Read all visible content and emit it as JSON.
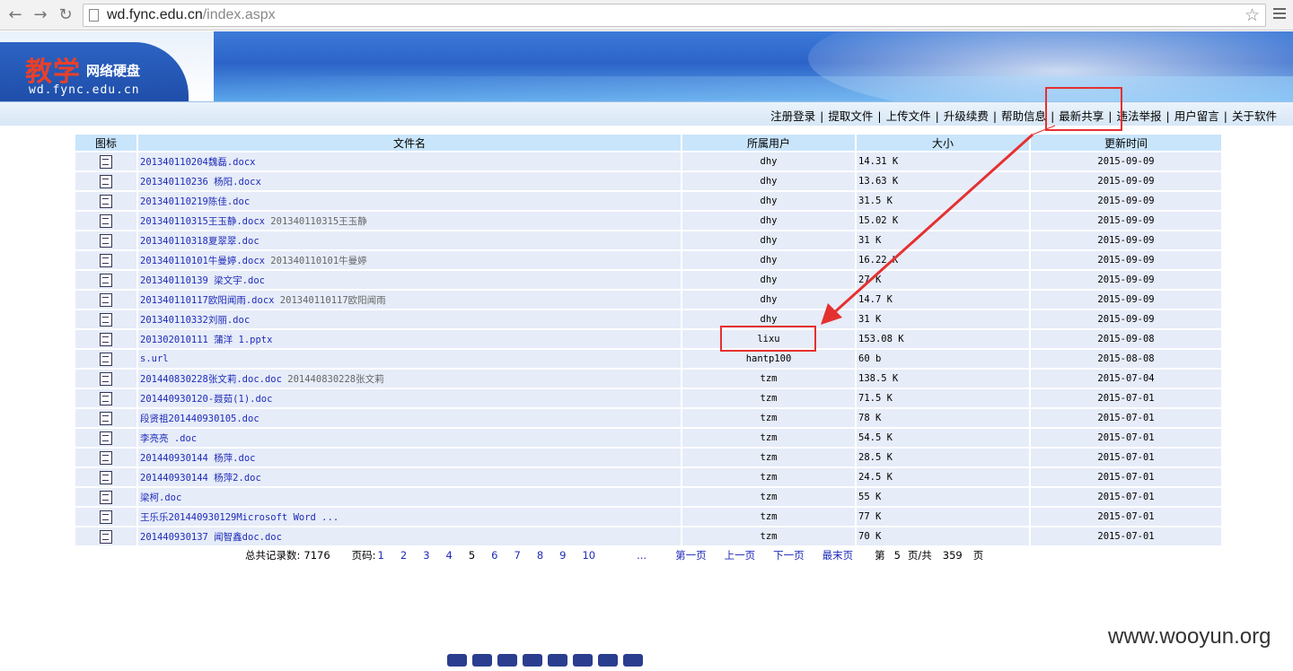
{
  "browser": {
    "url_host": "wd.fync.edu.cn",
    "url_path": "/index.aspx"
  },
  "header": {
    "logo_title": "教学",
    "logo_sub": "网络硬盘",
    "logo_domain": "wd.fync.edu.cn"
  },
  "nav": {
    "links": [
      "注册登录",
      "提取文件",
      "上传文件",
      "升级续费",
      "帮助信息",
      "最新共享",
      "违法举报",
      "用户留言",
      "关于软件"
    ],
    "separator": "|"
  },
  "table": {
    "headers": [
      "图标",
      "文件名",
      "所属用户",
      "大小",
      "更新时间"
    ],
    "rows": [
      {
        "name": "201340110204魏磊.docx",
        "note": "",
        "user": "dhy",
        "size": "14.31 K",
        "time": "2015-09-09"
      },
      {
        "name": "201340110236 杨阳.docx",
        "note": "",
        "user": "dhy",
        "size": "13.63 K",
        "time": "2015-09-09"
      },
      {
        "name": "201340110219陈佳.doc",
        "note": "",
        "user": "dhy",
        "size": "31.5 K",
        "time": "2015-09-09"
      },
      {
        "name": "201340110315王玉静.docx",
        "note": "201340110315王玉静",
        "user": "dhy",
        "size": "15.02 K",
        "time": "2015-09-09"
      },
      {
        "name": "201340110318夏翠翠.doc",
        "note": "",
        "user": "dhy",
        "size": "31 K",
        "time": "2015-09-09"
      },
      {
        "name": "201340110101牛曼婷.docx",
        "note": "201340110101牛曼婷",
        "user": "dhy",
        "size": "16.22 K",
        "time": "2015-09-09"
      },
      {
        "name": "201340110139 梁文宇.doc",
        "note": "",
        "user": "dhy",
        "size": "27 K",
        "time": "2015-09-09"
      },
      {
        "name": "201340110117欧阳闻雨.docx",
        "note": "201340110117欧阳闻雨",
        "user": "dhy",
        "size": "14.7 K",
        "time": "2015-09-09"
      },
      {
        "name": "201340110332刘丽.doc",
        "note": "",
        "user": "dhy",
        "size": "31 K",
        "time": "2015-09-09"
      },
      {
        "name": "201302010111 蒲洋 1.pptx",
        "note": "",
        "user": "lixu",
        "size": "153.08 K",
        "time": "2015-09-08"
      },
      {
        "name": "s.url",
        "note": "",
        "user": "hantp100",
        "size": "60 b",
        "time": "2015-08-08"
      },
      {
        "name": "201440830228张文莉.doc.doc",
        "note": "201440830228张文莉",
        "user": "tzm",
        "size": "138.5 K",
        "time": "2015-07-04"
      },
      {
        "name": "201440930120-聂茹(1).doc",
        "note": "",
        "user": "tzm",
        "size": "71.5 K",
        "time": "2015-07-01"
      },
      {
        "name": "段贤祖201440930105.doc",
        "note": "",
        "user": "tzm",
        "size": "78 K",
        "time": "2015-07-01"
      },
      {
        "name": "李亮亮 .doc",
        "note": "",
        "user": "tzm",
        "size": "54.5 K",
        "time": "2015-07-01"
      },
      {
        "name": "201440930144 杨萍.doc",
        "note": "",
        "user": "tzm",
        "size": "28.5 K",
        "time": "2015-07-01"
      },
      {
        "name": "201440930144 杨萍2.doc",
        "note": "",
        "user": "tzm",
        "size": "24.5 K",
        "time": "2015-07-01"
      },
      {
        "name": "梁柯.doc",
        "note": "",
        "user": "tzm",
        "size": "55 K",
        "time": "2015-07-01"
      },
      {
        "name": "王乐乐201440930129Microsoft Word ...",
        "note": "",
        "user": "tzm",
        "size": "77 K",
        "time": "2015-07-01"
      },
      {
        "name": "201440930137 闻智鑫doc.doc",
        "note": "",
        "user": "tzm",
        "size": "70 K",
        "time": "2015-07-01"
      }
    ]
  },
  "pager": {
    "total_label": "总共记录数:",
    "total": "7176",
    "pages_label": "页码:",
    "pages": [
      "1",
      "2",
      "3",
      "4",
      "5",
      "6",
      "7",
      "8",
      "9",
      "10",
      "..."
    ],
    "current": "5",
    "first": "第一页",
    "prev": "上一页",
    "next": "下一页",
    "last": "最末页",
    "pos_prefix": "第",
    "pos_current": "5",
    "pos_mid": "页/共",
    "pos_total": "359",
    "pos_suffix": "页"
  },
  "watermark": "www.wooyun.org",
  "colors": {
    "annotation": "#e53030",
    "link": "#1f2bb8",
    "header_cell": "#c9e5fb",
    "row": "#e6ecf8"
  }
}
